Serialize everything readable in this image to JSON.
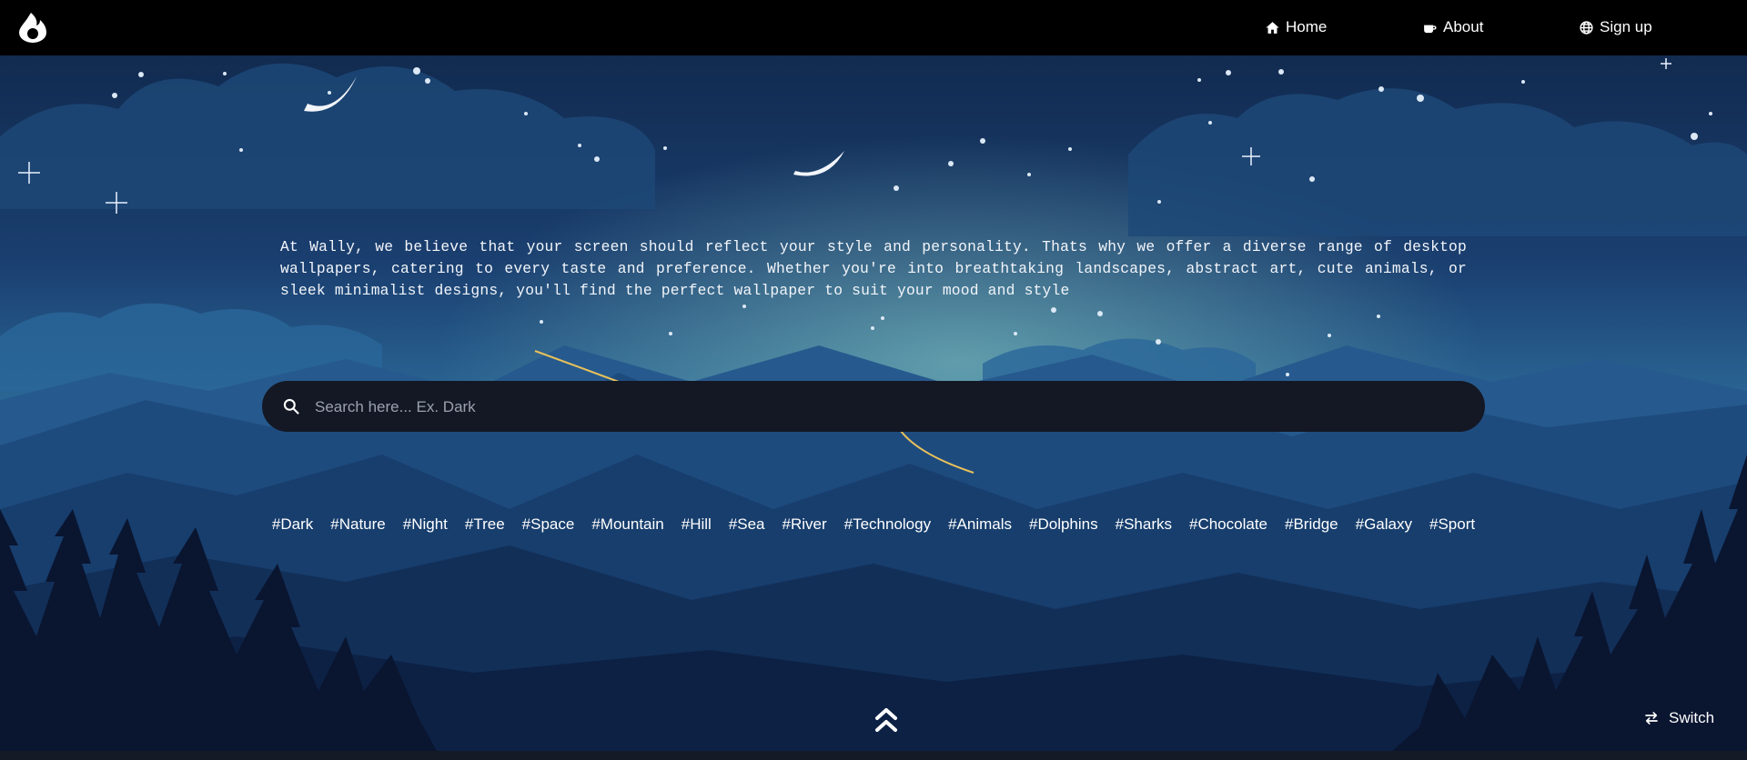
{
  "nav": {
    "logo_icon": "flame-icon",
    "links": [
      {
        "label": "Home",
        "icon": "home-icon"
      },
      {
        "label": "About",
        "icon": "coffee-cup-icon"
      },
      {
        "label": "Sign up",
        "icon": "globe-icon"
      }
    ]
  },
  "intro_text": "At Wally, we believe that your screen should reflect your style and personality. Thats why we offer a diverse range of desktop wallpapers, catering to every taste and preference. Whether you're into breathtaking landscapes, abstract art, cute animals, or sleek minimalist designs, you'll find the perfect wallpaper to suit your mood and style",
  "search": {
    "placeholder": "Search here... Ex. Dark",
    "value": "",
    "icon": "search-icon"
  },
  "tags": [
    "#Dark",
    "#Nature",
    "#Night",
    "#Tree",
    "#Space",
    "#Mountain",
    "#Hill",
    "#Sea",
    "#River",
    "#Technology",
    "#Animals",
    "#Dolphins",
    "#Sharks",
    "#Chocolate",
    "#Bridge",
    "#Galaxy",
    "#Sport"
  ],
  "scroll_top_icon": "double-chevron-up-icon",
  "switch_button": {
    "label": "Switch",
    "icon": "swap-arrows-icon"
  },
  "colors": {
    "navbar": "#000000",
    "search_bg": "#141824",
    "sky_top": "#0f2547",
    "sky_horizon": "#3b86ad",
    "mountains_dark": "#0a1530"
  }
}
